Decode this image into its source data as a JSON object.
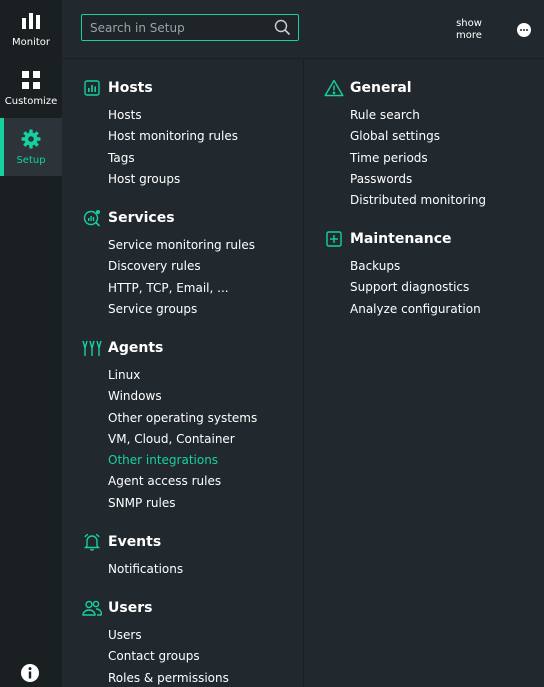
{
  "colors": {
    "accent": "#15d1a0",
    "background": "#22292e",
    "rail_background": "#1a1f22"
  },
  "rail": {
    "items": [
      {
        "label": "Monitor",
        "icon": "bar-chart-icon"
      },
      {
        "label": "Customize",
        "icon": "grid-icon"
      },
      {
        "label": "Setup",
        "icon": "gear-icon",
        "active": true
      }
    ],
    "bottom_icon": "info-icon"
  },
  "search": {
    "placeholder": "Search in Setup",
    "value": ""
  },
  "topbar": {
    "show_more_label": "show more",
    "more_icon": "more-horizontal-icon"
  },
  "sections": {
    "hosts": {
      "title": "Hosts",
      "icon": "hosts-icon",
      "items": [
        "Hosts",
        "Host monitoring rules",
        "Tags",
        "Host groups"
      ]
    },
    "services": {
      "title": "Services",
      "icon": "services-icon",
      "items": [
        "Service monitoring rules",
        "Discovery rules",
        "HTTP, TCP, Email, ...",
        "Service groups"
      ]
    },
    "agents": {
      "title": "Agents",
      "icon": "agents-icon",
      "items": [
        "Linux",
        "Windows",
        "Other operating systems",
        "VM, Cloud, Container",
        "Other integrations",
        "Agent access rules",
        "SNMP rules"
      ],
      "highlighted_item": "Other integrations"
    },
    "events": {
      "title": "Events",
      "icon": "bell-icon",
      "items": [
        "Notifications"
      ]
    },
    "users": {
      "title": "Users",
      "icon": "users-icon",
      "items": [
        "Users",
        "Contact groups",
        "Roles & permissions"
      ]
    },
    "general": {
      "title": "General",
      "icon": "warning-icon",
      "items": [
        "Rule search",
        "Global settings",
        "Time periods",
        "Passwords",
        "Distributed monitoring"
      ]
    },
    "maintenance": {
      "title": "Maintenance",
      "icon": "plus-square-icon",
      "items": [
        "Backups",
        "Support diagnostics",
        "Analyze configuration"
      ]
    }
  }
}
